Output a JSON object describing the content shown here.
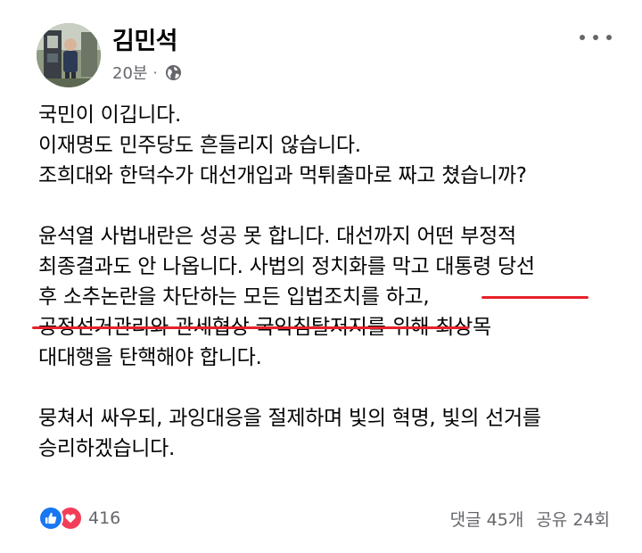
{
  "post": {
    "author": "김민석",
    "time": "20분",
    "separator": "·",
    "privacy_icon": "globe-icon",
    "more_icon": "more-options-icon",
    "paragraphs": [
      [
        "국민이 이깁니다.",
        "이재명도 민주당도 흔들리지 않습니다.",
        "조희대와 한덕수가 대선개입과 먹튀출마로 짜고 쳤습니까?"
      ],
      [
        "윤석열 사법내란은 성공 못 합니다. 대선까지 어떤 부정적",
        "최종결과도 안 나옵니다. 사법의 정치화를 막고 대통령 당선",
        "후 소추논란을 차단하는 모든 입법조치를 하고,",
        "공정선거관리와 관세협상 국익침탈저지를 위해 최상목",
        "대대행을 탄핵해야 합니다."
      ],
      [
        "뭉쳐서 싸우되, 과잉대응을 절제하며 빛의 혁명, 빛의 선거를",
        "승리하겠습니다."
      ]
    ],
    "underline_color": "#e8212b"
  },
  "footer": {
    "reaction_icons": [
      "like-icon",
      "love-icon"
    ],
    "reaction_count": "416",
    "comments": "댓글 45개",
    "shares": "공유 24회"
  },
  "colors": {
    "text": "#050505",
    "secondary": "#65676b",
    "like": "#1877f2",
    "love": "#f33e58"
  }
}
